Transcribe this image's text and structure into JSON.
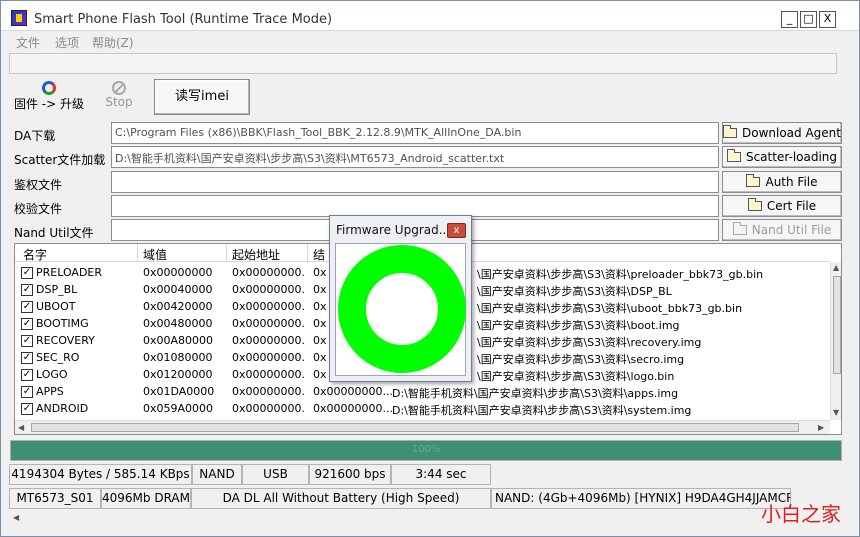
{
  "window": {
    "title": "Smart Phone Flash Tool (Runtime Trace Mode)",
    "controls": {
      "minimize": "_",
      "maximize": "□",
      "close": "X"
    }
  },
  "menu": {
    "file": "文件",
    "options": "选项",
    "help": "帮助(Z)"
  },
  "toolbar": {
    "upgrade_label": "固件 -> 升级",
    "stop_label": "Stop",
    "imei_label": "读写imei"
  },
  "files": [
    {
      "label": "DA下载",
      "path": "C:\\Program Files (x86)\\BBK\\Flash_Tool_BBK_2.12.8.9\\MTK_AllInOne_DA.bin",
      "button": "Download Agent",
      "enabled": true
    },
    {
      "label": "Scatter文件加载",
      "path": "D:\\智能手机资料\\国产安卓资料\\步步高\\S3\\资料\\MT6573_Android_scatter.txt",
      "button": "Scatter-loading",
      "enabled": true
    },
    {
      "label": "鉴权文件",
      "path": "",
      "button": "Auth File",
      "enabled": true
    },
    {
      "label": "校验文件",
      "path": "",
      "button": "Cert File",
      "enabled": true
    },
    {
      "label": "Nand Util文件",
      "path": "",
      "button": "Nand Util File",
      "enabled": false
    }
  ],
  "table": {
    "headers": {
      "name": "名字",
      "region": "域值",
      "start": "起始地址",
      "end": "结"
    },
    "rows": [
      {
        "checked": "✓",
        "name": "PRELOADER",
        "region": "0x00000000",
        "start": "0x00000000...",
        "end": "0x",
        "path": "\\国产安卓资料\\步步高\\S3\\资料\\preloader_bbk73_gb.bin"
      },
      {
        "checked": "✓",
        "name": "DSP_BL",
        "region": "0x00040000",
        "start": "0x00000000...",
        "end": "0x",
        "path": "\\国产安卓资料\\步步高\\S3\\资料\\DSP_BL"
      },
      {
        "checked": "✓",
        "name": "UBOOT",
        "region": "0x00420000",
        "start": "0x00000000...",
        "end": "0x",
        "path": "\\国产安卓资料\\步步高\\S3\\资料\\uboot_bbk73_gb.bin"
      },
      {
        "checked": "✓",
        "name": "BOOTIMG",
        "region": "0x00480000",
        "start": "0x00000000...",
        "end": "0x",
        "path": "\\国产安卓资料\\步步高\\S3\\资料\\boot.img"
      },
      {
        "checked": "✓",
        "name": "RECOVERY",
        "region": "0x00A80000",
        "start": "0x00000000...",
        "end": "0x",
        "path": "\\国产安卓资料\\步步高\\S3\\资料\\recovery.img"
      },
      {
        "checked": "✓",
        "name": "SEC_RO",
        "region": "0x01080000",
        "start": "0x00000000...",
        "end": "0x",
        "path": "\\国产安卓资料\\步步高\\S3\\资料\\secro.img"
      },
      {
        "checked": "✓",
        "name": "LOGO",
        "region": "0x01200000",
        "start": "0x00000000...",
        "end": "0x",
        "path": "\\国产安卓资料\\步步高\\S3\\资料\\logo.bin"
      },
      {
        "checked": "✓",
        "name": "APPS",
        "region": "0x01DA0000",
        "start": "0x00000000...",
        "end": "0x00000000...",
        "path": "D:\\智能手机资料\\国产安卓资料\\步步高\\S3\\资料\\apps.img"
      },
      {
        "checked": "✓",
        "name": "ANDROID",
        "region": "0x059A0000",
        "start": "0x00000000...",
        "end": "0x00000000...",
        "path": "D:\\智能手机资料\\国产安卓资料\\步步高\\S3\\资料\\system.img"
      }
    ]
  },
  "progress": {
    "percent_text": "100%",
    "fraction": 1.0,
    "color": "#3f8f72"
  },
  "status1": {
    "rate": "4194304 Bytes / 585.14 KBps",
    "storage": "NAND",
    "interface": "USB",
    "baud": "921600 bps",
    "time": "3:44 sec"
  },
  "status2": {
    "chip": "MT6573_S01",
    "dram": "4096Mb DRAM",
    "mode": "DA DL All Without Battery (High Speed)",
    "nand": "NAND: (4Gb+4096Mb) [HYNIX] H9DA4GH4JJAMCR"
  },
  "watermark": "小白之家",
  "dialog": {
    "title": "Firmware Upgrad...",
    "close": "x",
    "ring_color": "#00ff00"
  }
}
